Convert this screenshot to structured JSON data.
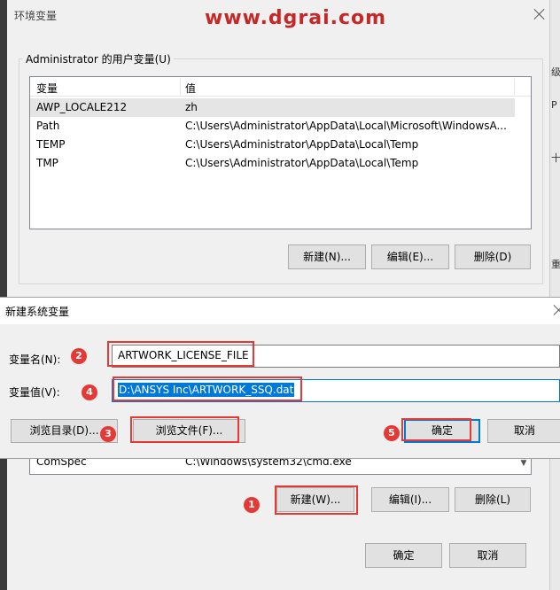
{
  "watermark": "www.dgrai.com",
  "env_window": {
    "title": "环境变量",
    "user_vars": {
      "group_label": "Administrator 的用户变量(U)",
      "columns": [
        "变量",
        "值"
      ],
      "rows": [
        {
          "name": "AWP_LOCALE212",
          "value": "zh"
        },
        {
          "name": "Path",
          "value": "C:\\Users\\Administrator\\AppData\\Local\\Microsoft\\WindowsA..."
        },
        {
          "name": "TEMP",
          "value": "C:\\Users\\Administrator\\AppData\\Local\\Temp"
        },
        {
          "name": "TMP",
          "value": "C:\\Users\\Administrator\\AppData\\Local\\Temp"
        }
      ],
      "buttons": {
        "new": "新建(N)...",
        "edit": "编辑(E)...",
        "delete": "删除(D)"
      }
    },
    "system_vars": {
      "rows": [
        {
          "name": "ComSpec",
          "value": "C:\\Windows\\system32\\cmd.exe"
        }
      ],
      "buttons": {
        "new": "新建(W)...",
        "edit": "编辑(I)...",
        "delete": "删除(L)"
      }
    },
    "footer": {
      "ok": "确定",
      "cancel": "取消"
    },
    "side_chars": [
      "级",
      "P",
      "十",
      "重"
    ]
  },
  "new_dialog": {
    "title": "新建系统变量",
    "name_label": "变量名(N):",
    "name_value": "ARTWORK_LICENSE_FILE",
    "value_label": "变量值(V):",
    "value_value": "D:\\ANSYS Inc\\ARTWORK_SSQ.dat",
    "buttons": {
      "browse_dir": "浏览目录(D)...",
      "browse_file": "浏览文件(F)...",
      "ok": "确定",
      "cancel": "取消"
    }
  },
  "annotations": [
    "1",
    "2",
    "3",
    "4",
    "5"
  ],
  "colors": {
    "annotation_red": "#e53935",
    "selection_blue": "#0078d7",
    "watermark_red": "#c62828"
  }
}
